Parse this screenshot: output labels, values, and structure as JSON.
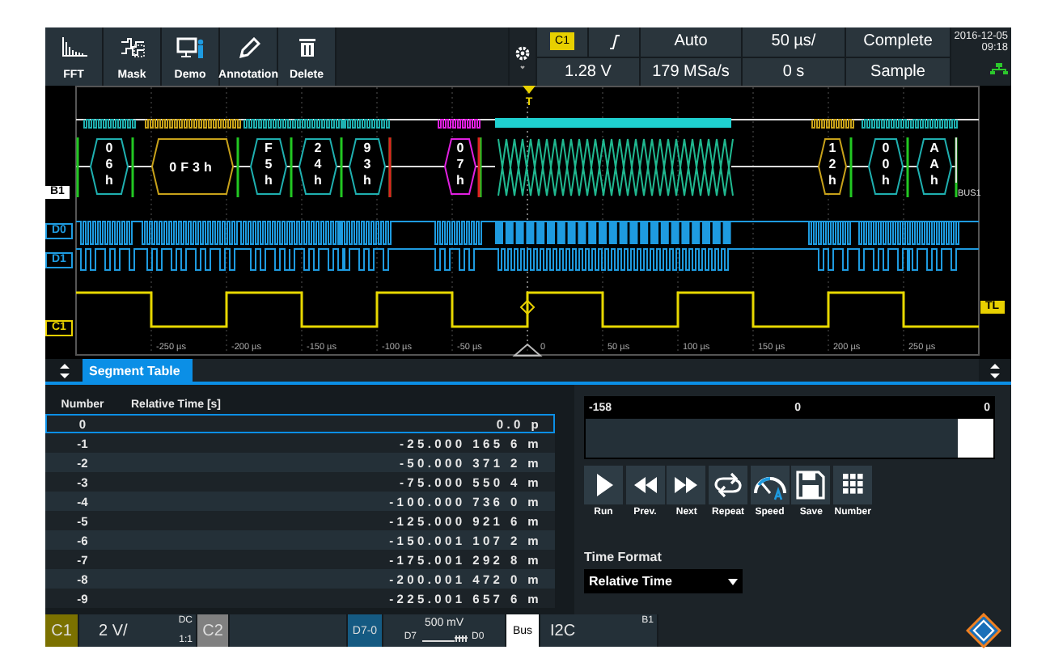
{
  "toolbar": [
    {
      "label": "FFT",
      "kind": "fft"
    },
    {
      "label": "Mask",
      "kind": "mask"
    },
    {
      "label": "Demo",
      "kind": "demo"
    },
    {
      "label": "Annotation",
      "kind": "annotation"
    },
    {
      "label": "Delete",
      "kind": "delete"
    }
  ],
  "trigger": {
    "source": "C1",
    "mode": "Auto",
    "level": "1.28 V",
    "timebase": "50 µs/",
    "sample_rate": "179 MSa/s",
    "position": "0 s",
    "acquisition_state": "Complete",
    "acquisition_mode": "Sample"
  },
  "clock": {
    "date": "2016-12-05",
    "time": "09:18"
  },
  "waveform": {
    "trigger_marker": "T",
    "trigger_level_label": "TL",
    "bus_name": "BUS1",
    "channel_labels": [
      {
        "label": "B1",
        "kind": "bus"
      },
      {
        "label": "D0",
        "kind": "digital"
      },
      {
        "label": "D1",
        "kind": "digital"
      },
      {
        "label": "C1",
        "kind": "analog"
      }
    ],
    "frames": [
      {
        "value": "06h",
        "color": "#1fb0b0"
      },
      {
        "value": "0F3h",
        "color": "#c8a21a"
      },
      {
        "value": "F5h",
        "color": "#1fb0b0"
      },
      {
        "value": "24h",
        "color": "#1fb0b0"
      },
      {
        "value": "93h",
        "color": "#1fb0b0"
      },
      {
        "value": "07h",
        "color": "#e020e0"
      },
      {
        "value": "12h",
        "color": "#c8a21a"
      },
      {
        "value": "00h",
        "color": "#1fb0b0"
      },
      {
        "value": "AAh",
        "color": "#1fb0b0"
      }
    ],
    "time_labels": [
      "-250 µs",
      "-200 µs",
      "-150 µs",
      "-100 µs",
      "-50 µs",
      "0",
      "50 µs",
      "100 µs",
      "150 µs",
      "200 µs",
      "250 µs"
    ]
  },
  "segment_table": {
    "tab": "Segment Table",
    "columns": [
      "Number",
      "Relative Time [s]"
    ],
    "rows": [
      {
        "number": "0",
        "time": "0.0 p",
        "selected": true
      },
      {
        "number": "-1",
        "time": "-25.000 165 6 m",
        "selected": false
      },
      {
        "number": "-2",
        "time": "-50.000 371 2 m",
        "selected": false
      },
      {
        "number": "-3",
        "time": "-75.000 550 4 m",
        "selected": false
      },
      {
        "number": "-4",
        "time": "-100.000 736 0 m",
        "selected": false
      },
      {
        "number": "-5",
        "time": "-125.000 921 6 m",
        "selected": false
      },
      {
        "number": "-6",
        "time": "-150.001 107 2 m",
        "selected": false
      },
      {
        "number": "-7",
        "time": "-175.001 292 8 m",
        "selected": false
      },
      {
        "number": "-8",
        "time": "-200.001 472 0 m",
        "selected": false
      },
      {
        "number": "-9",
        "time": "-225.001 657 6 m",
        "selected": false
      }
    ]
  },
  "histogram": {
    "labels": [
      "-158",
      "0",
      "0"
    ]
  },
  "player": [
    {
      "label": "Run",
      "kind": "play"
    },
    {
      "label": "Prev.",
      "kind": "prev"
    },
    {
      "label": "Next",
      "kind": "next"
    },
    {
      "label": "Repeat",
      "kind": "repeat"
    },
    {
      "label": "Speed",
      "kind": "speed"
    },
    {
      "label": "Save",
      "kind": "save"
    },
    {
      "label": "Number",
      "kind": "number"
    }
  ],
  "time_format": {
    "label": "Time Format",
    "value": "Relative Time"
  },
  "channel_bar": {
    "c1": {
      "label": "C1",
      "scale": "2 V/",
      "coupling": "DC",
      "probe": "1:1"
    },
    "c2": {
      "label": "C2"
    },
    "digital": {
      "label": "D7-0",
      "threshold": "500 mV",
      "from": "D7",
      "to": "D0"
    },
    "bus": {
      "label": "Bus",
      "protocol": "I2C",
      "id": "B1"
    }
  }
}
